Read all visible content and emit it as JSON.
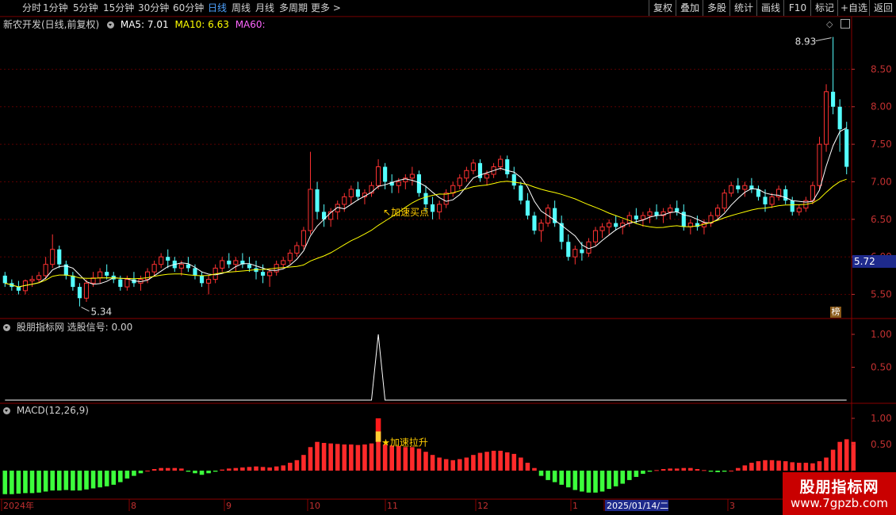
{
  "toolbar": {
    "periods": [
      "分时",
      "1分钟",
      "5分钟",
      "15分钟",
      "30分钟",
      "60分钟",
      "日线",
      "周线",
      "月线",
      "多周期",
      "更多 >"
    ],
    "active_period": "日线",
    "right_buttons": [
      "复权",
      "叠加",
      "多股",
      "统计",
      "画线",
      "F10",
      "标记",
      "+自选",
      "返回"
    ]
  },
  "main_panel": {
    "stock_title": "新农开发(日线,前复权)",
    "ma5_label": "MA5: 7.01",
    "ma10_label": "MA10: 6.63",
    "ma60_label": "MA60:",
    "ma5_color": "#ffffff",
    "ma10_color": "#ffff00",
    "ma60_color": "#ff66ff",
    "high_marker": "8.93",
    "low_marker": "5.34",
    "annotation": "加速买点",
    "current_price_tag": "5.72",
    "badge": "榜",
    "y_ticks": [
      "8.50",
      "8.00",
      "7.50",
      "7.00",
      "6.50",
      "6.00",
      "5.50"
    ]
  },
  "signal_panel": {
    "title": "股朋指标网 选股信号: 0.00",
    "y_ticks": [
      "1.00",
      "0.50"
    ]
  },
  "macd_panel": {
    "title": "MACD(12,26,9)",
    "annotation": "加速拉升",
    "y_ticks": [
      "1.00",
      "0.50"
    ]
  },
  "x_axis": {
    "labels": [
      "2024年",
      "8",
      "9",
      "10",
      "11",
      "12",
      "1",
      "2025/01/14/二",
      "3"
    ]
  },
  "watermark": {
    "line1": "股朋指标网",
    "line2": "www.7gpzb.com"
  },
  "chart_data": {
    "type": "candlestick",
    "y_range": [
      5.2,
      9.0
    ],
    "candles_ohlc": [
      [
        5.75,
        5.8,
        5.6,
        5.65
      ],
      [
        5.65,
        5.7,
        5.55,
        5.6
      ],
      [
        5.6,
        5.68,
        5.5,
        5.55
      ],
      [
        5.55,
        5.7,
        5.5,
        5.68
      ],
      [
        5.68,
        5.75,
        5.6,
        5.7
      ],
      [
        5.7,
        5.8,
        5.65,
        5.75
      ],
      [
        5.75,
        6.0,
        5.7,
        5.9
      ],
      [
        5.9,
        6.3,
        5.85,
        6.1
      ],
      [
        6.1,
        6.15,
        5.85,
        5.9
      ],
      [
        5.9,
        5.95,
        5.7,
        5.75
      ],
      [
        5.75,
        5.8,
        5.55,
        5.6
      ],
      [
        5.6,
        5.65,
        5.34,
        5.45
      ],
      [
        5.45,
        5.7,
        5.4,
        5.65
      ],
      [
        5.65,
        5.8,
        5.6,
        5.72
      ],
      [
        5.72,
        5.85,
        5.65,
        5.8
      ],
      [
        5.8,
        5.9,
        5.7,
        5.75
      ],
      [
        5.75,
        5.8,
        5.65,
        5.7
      ],
      [
        5.7,
        5.75,
        5.55,
        5.6
      ],
      [
        5.6,
        5.75,
        5.55,
        5.7
      ],
      [
        5.7,
        5.8,
        5.6,
        5.65
      ],
      [
        5.65,
        5.75,
        5.55,
        5.7
      ],
      [
        5.7,
        5.85,
        5.65,
        5.8
      ],
      [
        5.8,
        5.95,
        5.75,
        5.9
      ],
      [
        5.9,
        6.05,
        5.85,
        6.0
      ],
      [
        6.0,
        6.1,
        5.85,
        5.95
      ],
      [
        5.95,
        6.0,
        5.8,
        5.85
      ],
      [
        5.85,
        5.95,
        5.75,
        5.9
      ],
      [
        5.9,
        6.0,
        5.8,
        5.85
      ],
      [
        5.85,
        5.9,
        5.7,
        5.75
      ],
      [
        5.75,
        5.8,
        5.6,
        5.65
      ],
      [
        5.65,
        5.75,
        5.5,
        5.7
      ],
      [
        5.7,
        5.9,
        5.65,
        5.85
      ],
      [
        5.85,
        6.0,
        5.8,
        5.95
      ],
      [
        5.95,
        6.05,
        5.85,
        5.9
      ],
      [
        5.9,
        6.0,
        5.8,
        5.95
      ],
      [
        5.95,
        6.05,
        5.85,
        5.9
      ],
      [
        5.9,
        6.0,
        5.8,
        5.85
      ],
      [
        5.85,
        5.95,
        5.7,
        5.8
      ],
      [
        5.8,
        5.9,
        5.65,
        5.75
      ],
      [
        5.75,
        5.85,
        5.6,
        5.8
      ],
      [
        5.8,
        5.95,
        5.75,
        5.9
      ],
      [
        5.9,
        6.0,
        5.85,
        5.95
      ],
      [
        5.95,
        6.1,
        5.9,
        6.05
      ],
      [
        6.05,
        6.2,
        6.0,
        6.15
      ],
      [
        6.15,
        6.4,
        6.1,
        6.35
      ],
      [
        6.35,
        7.4,
        6.3,
        6.9
      ],
      [
        6.9,
        7.0,
        6.5,
        6.6
      ],
      [
        6.6,
        6.7,
        6.4,
        6.5
      ],
      [
        6.5,
        6.65,
        6.4,
        6.6
      ],
      [
        6.6,
        6.75,
        6.5,
        6.7
      ],
      [
        6.7,
        6.85,
        6.6,
        6.8
      ],
      [
        6.8,
        6.95,
        6.7,
        6.9
      ],
      [
        6.9,
        7.0,
        6.75,
        6.8
      ],
      [
        6.8,
        6.9,
        6.7,
        6.85
      ],
      [
        6.85,
        7.0,
        6.8,
        6.95
      ],
      [
        6.95,
        7.3,
        6.9,
        7.2
      ],
      [
        7.2,
        7.25,
        6.9,
        7.0
      ],
      [
        7.0,
        7.1,
        6.85,
        6.95
      ],
      [
        6.95,
        7.05,
        6.85,
        7.0
      ],
      [
        7.0,
        7.1,
        6.9,
        7.05
      ],
      [
        7.05,
        7.2,
        6.95,
        7.1
      ],
      [
        7.1,
        7.15,
        6.8,
        6.85
      ],
      [
        6.85,
        6.95,
        6.6,
        6.7
      ],
      [
        6.7,
        6.8,
        6.5,
        6.6
      ],
      [
        6.6,
        6.75,
        6.5,
        6.7
      ],
      [
        6.7,
        6.9,
        6.65,
        6.85
      ],
      [
        6.85,
        7.0,
        6.8,
        6.95
      ],
      [
        6.95,
        7.1,
        6.9,
        7.05
      ],
      [
        7.05,
        7.2,
        7.0,
        7.15
      ],
      [
        7.15,
        7.3,
        7.1,
        7.25
      ],
      [
        7.25,
        7.3,
        7.0,
        7.05
      ],
      [
        7.05,
        7.15,
        6.95,
        7.1
      ],
      [
        7.1,
        7.25,
        7.05,
        7.2
      ],
      [
        7.2,
        7.35,
        7.15,
        7.3
      ],
      [
        7.3,
        7.35,
        7.05,
        7.1
      ],
      [
        7.1,
        7.2,
        6.9,
        6.95
      ],
      [
        6.95,
        7.0,
        6.7,
        6.75
      ],
      [
        6.75,
        6.85,
        6.5,
        6.55
      ],
      [
        6.55,
        6.6,
        6.3,
        6.35
      ],
      [
        6.35,
        6.5,
        6.2,
        6.45
      ],
      [
        6.45,
        6.7,
        6.4,
        6.65
      ],
      [
        6.65,
        6.75,
        6.4,
        6.45
      ],
      [
        6.45,
        6.55,
        6.1,
        6.2
      ],
      [
        6.2,
        6.3,
        5.95,
        6.0
      ],
      [
        6.0,
        6.15,
        5.9,
        6.1
      ],
      [
        6.1,
        6.2,
        5.95,
        6.05
      ],
      [
        6.05,
        6.25,
        6.0,
        6.2
      ],
      [
        6.2,
        6.4,
        6.15,
        6.35
      ],
      [
        6.35,
        6.45,
        6.25,
        6.4
      ],
      [
        6.4,
        6.5,
        6.3,
        6.45
      ],
      [
        6.45,
        6.55,
        6.35,
        6.4
      ],
      [
        6.4,
        6.5,
        6.3,
        6.45
      ],
      [
        6.45,
        6.6,
        6.4,
        6.55
      ],
      [
        6.55,
        6.65,
        6.45,
        6.5
      ],
      [
        6.5,
        6.6,
        6.4,
        6.55
      ],
      [
        6.55,
        6.65,
        6.45,
        6.6
      ],
      [
        6.6,
        6.7,
        6.5,
        6.55
      ],
      [
        6.55,
        6.65,
        6.45,
        6.6
      ],
      [
        6.6,
        6.7,
        6.5,
        6.65
      ],
      [
        6.65,
        6.75,
        6.55,
        6.6
      ],
      [
        6.6,
        6.7,
        6.35,
        6.4
      ],
      [
        6.4,
        6.5,
        6.3,
        6.45
      ],
      [
        6.45,
        6.55,
        6.35,
        6.4
      ],
      [
        6.4,
        6.5,
        6.3,
        6.45
      ],
      [
        6.45,
        6.6,
        6.4,
        6.55
      ],
      [
        6.55,
        6.7,
        6.5,
        6.65
      ],
      [
        6.65,
        6.9,
        6.6,
        6.85
      ],
      [
        6.85,
        7.0,
        6.8,
        6.95
      ],
      [
        6.95,
        7.05,
        6.85,
        6.9
      ],
      [
        6.9,
        7.0,
        6.8,
        6.95
      ],
      [
        6.95,
        7.05,
        6.85,
        6.9
      ],
      [
        6.9,
        6.95,
        6.75,
        6.8
      ],
      [
        6.8,
        6.9,
        6.6,
        6.7
      ],
      [
        6.7,
        6.85,
        6.65,
        6.8
      ],
      [
        6.8,
        6.95,
        6.75,
        6.9
      ],
      [
        6.9,
        6.95,
        6.7,
        6.75
      ],
      [
        6.75,
        6.8,
        6.55,
        6.6
      ],
      [
        6.6,
        6.7,
        6.55,
        6.65
      ],
      [
        6.65,
        6.8,
        6.6,
        6.75
      ],
      [
        6.75,
        7.0,
        6.7,
        6.95
      ],
      [
        6.95,
        7.6,
        6.9,
        7.5
      ],
      [
        7.5,
        8.3,
        7.4,
        8.2
      ],
      [
        8.2,
        8.93,
        7.9,
        8.0
      ],
      [
        8.0,
        8.1,
        7.4,
        7.7
      ],
      [
        7.7,
        7.8,
        7.1,
        7.2
      ]
    ],
    "signal_values": [
      0,
      0,
      0,
      0,
      0,
      0,
      0,
      0,
      0,
      0,
      0,
      0,
      0,
      0,
      0,
      0,
      0,
      0,
      0,
      0,
      0,
      0,
      0,
      0,
      0,
      0,
      0,
      0,
      0,
      0,
      0,
      0,
      0,
      0,
      0,
      0,
      0,
      0,
      0,
      0,
      0,
      0,
      0,
      0,
      0,
      0,
      0,
      0,
      0,
      0,
      0,
      0,
      0,
      0,
      0,
      1,
      0,
      0,
      0,
      0,
      0,
      0,
      0,
      0,
      0,
      0,
      0,
      0,
      0,
      0,
      0,
      0,
      0,
      0,
      0,
      0,
      0,
      0,
      0,
      0,
      0,
      0,
      0,
      0,
      0,
      0,
      0,
      0,
      0,
      0,
      0,
      0,
      0,
      0,
      0,
      0,
      0,
      0,
      0,
      0,
      0,
      0,
      0,
      0,
      0,
      0,
      0,
      0,
      0,
      0,
      0,
      0,
      0,
      0,
      0,
      0,
      0,
      0,
      0,
      0,
      0,
      0,
      0,
      0,
      0
    ],
    "macd_values": [
      -0.45,
      -0.45,
      -0.44,
      -0.43,
      -0.43,
      -0.42,
      -0.4,
      -0.38,
      -0.38,
      -0.37,
      -0.38,
      -0.38,
      -0.36,
      -0.34,
      -0.32,
      -0.3,
      -0.27,
      -0.22,
      -0.15,
      -0.1,
      -0.05,
      0.0,
      0.03,
      0.05,
      0.05,
      0.05,
      0.04,
      -0.02,
      -0.05,
      -0.08,
      -0.05,
      -0.02,
      0.02,
      0.04,
      0.05,
      0.06,
      0.07,
      0.08,
      0.07,
      0.06,
      0.08,
      0.1,
      0.15,
      0.2,
      0.3,
      0.45,
      0.55,
      0.53,
      0.52,
      0.51,
      0.5,
      0.5,
      0.49,
      0.5,
      0.52,
      0.55,
      0.5,
      0.48,
      0.47,
      0.45,
      0.45,
      0.42,
      0.36,
      0.3,
      0.25,
      0.22,
      0.2,
      0.22,
      0.25,
      0.3,
      0.34,
      0.36,
      0.38,
      0.38,
      0.35,
      0.32,
      0.25,
      0.15,
      0.05,
      -0.1,
      -0.18,
      -0.22,
      -0.27,
      -0.32,
      -0.37,
      -0.4,
      -0.42,
      -0.42,
      -0.4,
      -0.35,
      -0.3,
      -0.25,
      -0.18,
      -0.12,
      -0.06,
      -0.02,
      0.01,
      0.03,
      0.04,
      0.04,
      0.05,
      0.05,
      0.03,
      0.01,
      -0.02,
      -0.03,
      -0.02,
      0.0,
      0.05,
      0.1,
      0.15,
      0.18,
      0.2,
      0.2,
      0.19,
      0.18,
      0.16,
      0.15,
      0.15,
      0.14,
      0.18,
      0.25,
      0.4,
      0.55,
      0.6,
      0.55
    ]
  }
}
